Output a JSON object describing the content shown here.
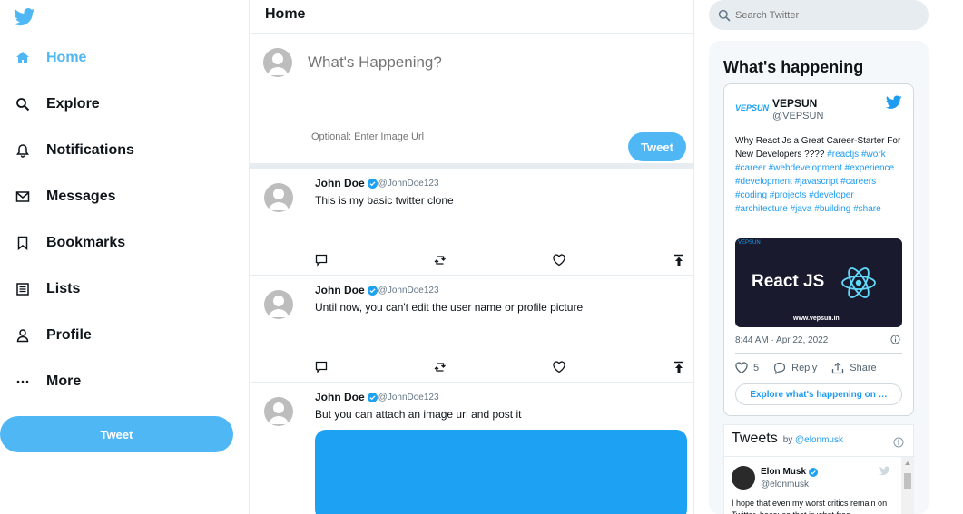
{
  "sidebar": {
    "items": [
      {
        "label": "Home",
        "icon": "home-icon"
      },
      {
        "label": "Explore",
        "icon": "search-icon"
      },
      {
        "label": "Notifications",
        "icon": "bell-icon"
      },
      {
        "label": "Messages",
        "icon": "mail-icon"
      },
      {
        "label": "Bookmarks",
        "icon": "bookmark-icon"
      },
      {
        "label": "Lists",
        "icon": "list-icon"
      },
      {
        "label": "Profile",
        "icon": "person-icon"
      },
      {
        "label": "More",
        "icon": "more-icon"
      }
    ],
    "tweet_label": "Tweet"
  },
  "feed": {
    "title": "Home",
    "composer": {
      "placeholder": "What's Happening?",
      "image_placeholder": "Optional: Enter Image Url",
      "tweet_label": "Tweet"
    },
    "posts": [
      {
        "name": "John Doe",
        "handle": "@JohnDoe123",
        "text": "This is my basic twitter clone"
      },
      {
        "name": "John Doe",
        "handle": "@JohnDoe123",
        "text": "Until now, you can't edit the user name or profile picture"
      },
      {
        "name": "John Doe",
        "handle": "@JohnDoe123",
        "text": "But you can attach an image url and post it"
      }
    ]
  },
  "widgets": {
    "search_placeholder": "Search Twitter",
    "title": "What's happening",
    "embed": {
      "logo_text": "VEPSUN",
      "name": "VEPSUN",
      "handle": "@VEPSUN",
      "text": "Why React Js a Great Career-Starter For New Developers ????",
      "hashtags": "#reactjs #work #career #webdevelopment #experience #development #javascript #careers #coding #projects #developer #architecture #java #building #share",
      "card_mini": "VEPSUN",
      "card_title": "React JS",
      "card_url": "www.vepsun.in",
      "time": "8:44 AM · Apr 22, 2022",
      "likes": "5",
      "reply_label": "Reply",
      "share_label": "Share",
      "explore_label": "Explore what's happening on …"
    },
    "timeline": {
      "title": "Tweets",
      "by_prefix": "by",
      "by_handle": "@elonmusk",
      "name": "Elon Musk",
      "handle": "@elonmusk",
      "text": "I hope that even my worst critics remain on Twitter, because that is what free"
    }
  },
  "colors": {
    "accent": "#50b7f5",
    "link": "#1d9bf0"
  }
}
